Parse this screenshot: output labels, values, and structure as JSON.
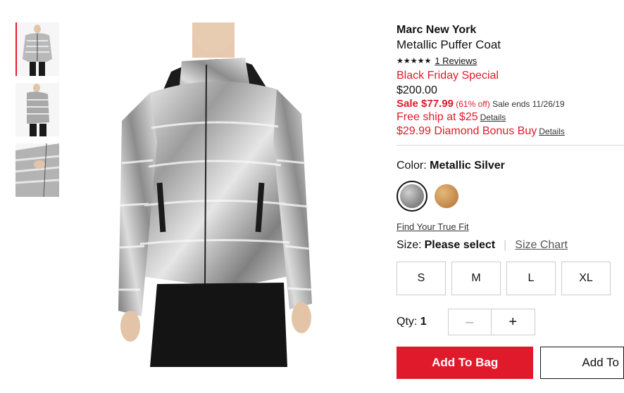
{
  "product": {
    "brand": "Marc New York",
    "name": "Metallic Puffer Coat",
    "stars": "★★★★★",
    "reviews_label": "1 Reviews",
    "promo_label": "Black Friday Special",
    "original_price": "$200.00",
    "sale_prefix": "Sale $77.99",
    "sale_percent": "(61% off)",
    "sale_ends": "Sale ends 11/26/19",
    "free_ship": "Free ship at $25",
    "free_ship_details": "Details",
    "bonus_buy": "$29.99 Diamond Bonus Buy",
    "bonus_details": "Details"
  },
  "color": {
    "label": "Color:",
    "selected": "Metallic Silver",
    "swatches": [
      "Metallic Silver",
      "Tan"
    ],
    "swatch_colors": [
      "#9a9a9a",
      "#c68e4e"
    ]
  },
  "size": {
    "fit_link": "Find Your True Fit",
    "label": "Size:",
    "selected": "Please select",
    "chart_link": "Size Chart",
    "options": [
      "S",
      "M",
      "L",
      "XL"
    ]
  },
  "quantity": {
    "label": "Qty:",
    "value": "1",
    "minus": "–",
    "plus": "+"
  },
  "actions": {
    "add_to_bag": "Add To Bag",
    "add_to_list": "Add To"
  },
  "colors": {
    "accent_red": "#e11a2b"
  }
}
